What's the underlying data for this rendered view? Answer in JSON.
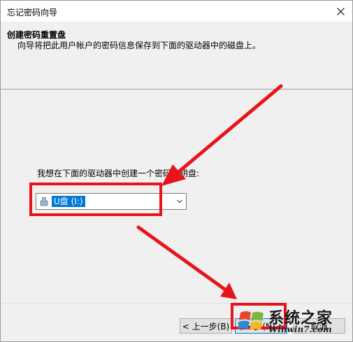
{
  "window": {
    "title": "忘记密码向导"
  },
  "header": {
    "title": "创建密码重置盘",
    "description": "向导将把此用户帐户的密码信息保存到下面的驱动器中的磁盘上。"
  },
  "body": {
    "prompt": "我想在下面的驱动器中创建一个密码密钥盘:",
    "drive_select": {
      "selected": "U盘 (I:)"
    }
  },
  "footer": {
    "back_label": "< 上一步(B)",
    "next_label": "下一步(N) >",
    "cancel_label": "取消"
  },
  "watermark": {
    "brand": "系统之家",
    "url": "Winwin7.com",
    "logo_text": "Win7"
  },
  "colors": {
    "accent": "#0078d7",
    "annotation": "#e8141b"
  },
  "icons": [
    "close-icon",
    "usb-drive-icon",
    "chevron-down-icon",
    "windows-logo-icon"
  ]
}
